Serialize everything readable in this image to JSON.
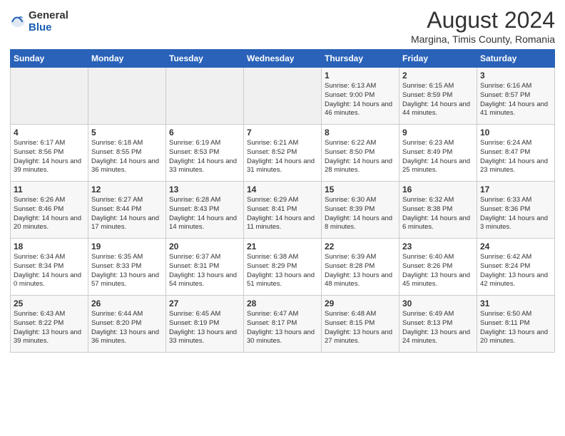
{
  "header": {
    "logo_general": "General",
    "logo_blue": "Blue",
    "title": "August 2024",
    "subtitle": "Margina, Timis County, Romania"
  },
  "weekdays": [
    "Sunday",
    "Monday",
    "Tuesday",
    "Wednesday",
    "Thursday",
    "Friday",
    "Saturday"
  ],
  "weeks": [
    [
      {
        "day": "",
        "info": ""
      },
      {
        "day": "",
        "info": ""
      },
      {
        "day": "",
        "info": ""
      },
      {
        "day": "",
        "info": ""
      },
      {
        "day": "1",
        "info": "Sunrise: 6:13 AM\nSunset: 9:00 PM\nDaylight: 14 hours and 46 minutes."
      },
      {
        "day": "2",
        "info": "Sunrise: 6:15 AM\nSunset: 8:59 PM\nDaylight: 14 hours and 44 minutes."
      },
      {
        "day": "3",
        "info": "Sunrise: 6:16 AM\nSunset: 8:57 PM\nDaylight: 14 hours and 41 minutes."
      }
    ],
    [
      {
        "day": "4",
        "info": "Sunrise: 6:17 AM\nSunset: 8:56 PM\nDaylight: 14 hours and 39 minutes."
      },
      {
        "day": "5",
        "info": "Sunrise: 6:18 AM\nSunset: 8:55 PM\nDaylight: 14 hours and 36 minutes."
      },
      {
        "day": "6",
        "info": "Sunrise: 6:19 AM\nSunset: 8:53 PM\nDaylight: 14 hours and 33 minutes."
      },
      {
        "day": "7",
        "info": "Sunrise: 6:21 AM\nSunset: 8:52 PM\nDaylight: 14 hours and 31 minutes."
      },
      {
        "day": "8",
        "info": "Sunrise: 6:22 AM\nSunset: 8:50 PM\nDaylight: 14 hours and 28 minutes."
      },
      {
        "day": "9",
        "info": "Sunrise: 6:23 AM\nSunset: 8:49 PM\nDaylight: 14 hours and 25 minutes."
      },
      {
        "day": "10",
        "info": "Sunrise: 6:24 AM\nSunset: 8:47 PM\nDaylight: 14 hours and 23 minutes."
      }
    ],
    [
      {
        "day": "11",
        "info": "Sunrise: 6:26 AM\nSunset: 8:46 PM\nDaylight: 14 hours and 20 minutes."
      },
      {
        "day": "12",
        "info": "Sunrise: 6:27 AM\nSunset: 8:44 PM\nDaylight: 14 hours and 17 minutes."
      },
      {
        "day": "13",
        "info": "Sunrise: 6:28 AM\nSunset: 8:43 PM\nDaylight: 14 hours and 14 minutes."
      },
      {
        "day": "14",
        "info": "Sunrise: 6:29 AM\nSunset: 8:41 PM\nDaylight: 14 hours and 11 minutes."
      },
      {
        "day": "15",
        "info": "Sunrise: 6:30 AM\nSunset: 8:39 PM\nDaylight: 14 hours and 8 minutes."
      },
      {
        "day": "16",
        "info": "Sunrise: 6:32 AM\nSunset: 8:38 PM\nDaylight: 14 hours and 6 minutes."
      },
      {
        "day": "17",
        "info": "Sunrise: 6:33 AM\nSunset: 8:36 PM\nDaylight: 14 hours and 3 minutes."
      }
    ],
    [
      {
        "day": "18",
        "info": "Sunrise: 6:34 AM\nSunset: 8:34 PM\nDaylight: 14 hours and 0 minutes."
      },
      {
        "day": "19",
        "info": "Sunrise: 6:35 AM\nSunset: 8:33 PM\nDaylight: 13 hours and 57 minutes."
      },
      {
        "day": "20",
        "info": "Sunrise: 6:37 AM\nSunset: 8:31 PM\nDaylight: 13 hours and 54 minutes."
      },
      {
        "day": "21",
        "info": "Sunrise: 6:38 AM\nSunset: 8:29 PM\nDaylight: 13 hours and 51 minutes."
      },
      {
        "day": "22",
        "info": "Sunrise: 6:39 AM\nSunset: 8:28 PM\nDaylight: 13 hours and 48 minutes."
      },
      {
        "day": "23",
        "info": "Sunrise: 6:40 AM\nSunset: 8:26 PM\nDaylight: 13 hours and 45 minutes."
      },
      {
        "day": "24",
        "info": "Sunrise: 6:42 AM\nSunset: 8:24 PM\nDaylight: 13 hours and 42 minutes."
      }
    ],
    [
      {
        "day": "25",
        "info": "Sunrise: 6:43 AM\nSunset: 8:22 PM\nDaylight: 13 hours and 39 minutes."
      },
      {
        "day": "26",
        "info": "Sunrise: 6:44 AM\nSunset: 8:20 PM\nDaylight: 13 hours and 36 minutes."
      },
      {
        "day": "27",
        "info": "Sunrise: 6:45 AM\nSunset: 8:19 PM\nDaylight: 13 hours and 33 minutes."
      },
      {
        "day": "28",
        "info": "Sunrise: 6:47 AM\nSunset: 8:17 PM\nDaylight: 13 hours and 30 minutes."
      },
      {
        "day": "29",
        "info": "Sunrise: 6:48 AM\nSunset: 8:15 PM\nDaylight: 13 hours and 27 minutes."
      },
      {
        "day": "30",
        "info": "Sunrise: 6:49 AM\nSunset: 8:13 PM\nDaylight: 13 hours and 24 minutes."
      },
      {
        "day": "31",
        "info": "Sunrise: 6:50 AM\nSunset: 8:11 PM\nDaylight: 13 hours and 20 minutes."
      }
    ]
  ]
}
